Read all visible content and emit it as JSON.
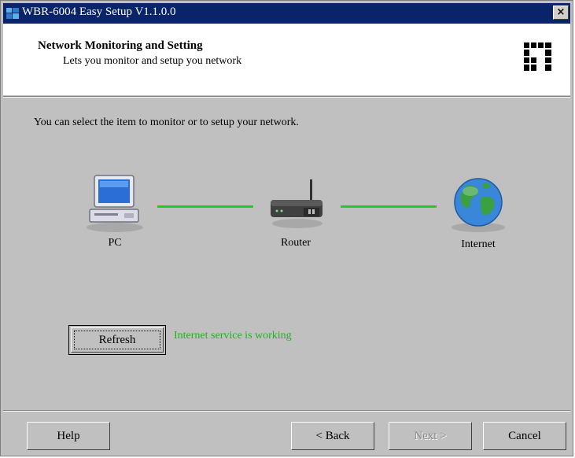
{
  "window": {
    "title": "WBR-6004 Easy Setup  V1.1.0.0",
    "close_label": "×"
  },
  "header": {
    "title": "Network Monitoring and Setting",
    "subtitle": "Lets you monitor and setup you network"
  },
  "main": {
    "instruction": "You can select the item to monitor or to setup your network.",
    "nodes": [
      {
        "label": "PC",
        "icon": "computer-icon"
      },
      {
        "label": "Router",
        "icon": "router-icon"
      },
      {
        "label": "Internet",
        "icon": "globe-icon"
      }
    ],
    "link_color": "#22cc22",
    "refresh_label": "Refresh",
    "status": "Internet service is working",
    "status_color": "#22b022"
  },
  "footer": {
    "help_label": "Help",
    "back_label": "< Back",
    "next_label": "Next >",
    "cancel_label": "Cancel"
  }
}
